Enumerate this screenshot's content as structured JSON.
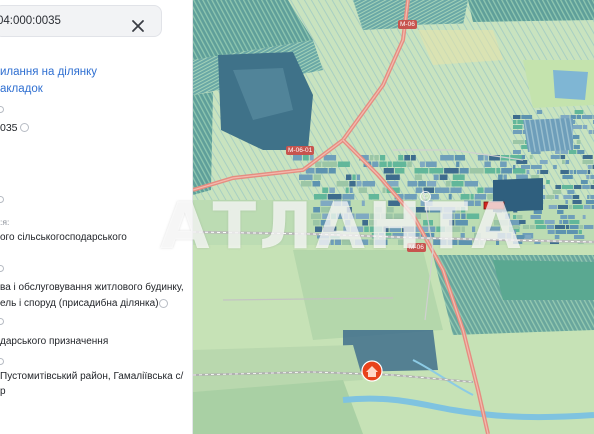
{
  "search": {
    "value": "04:000:0035"
  },
  "info_panel": {
    "link_line_1": "илання на ділянку",
    "link_line_2": "акладок",
    "cadastral_fragment": "035",
    "label_small": ":я:",
    "category_value": "ого сільськогосподарського",
    "purpose_line_1": "ва і обслуговування житлового будинку,",
    "purpose_line_2": "ель і споруд (присадибна ділянка)",
    "use_value": "дарського призначення",
    "location_line_1": "Пустомитівський район, Гамаліївська с/",
    "location_line_2": "р"
  },
  "map": {
    "road_labels": [
      "М-06",
      "М-06-01",
      "М-06"
    ],
    "watermark": "АТЛАНТА",
    "copyright_symbol": "©",
    "marker_symbol": "⌂",
    "colors": {
      "field_green": "#b9d9b0",
      "parcel_blue": "#6f9fba",
      "parcel_dark": "#3e6c8d",
      "parcel_teal": "#62b79a",
      "road": "#e28a7f",
      "selected_parcel": "#d5261f",
      "marker": "#e8421b"
    }
  }
}
